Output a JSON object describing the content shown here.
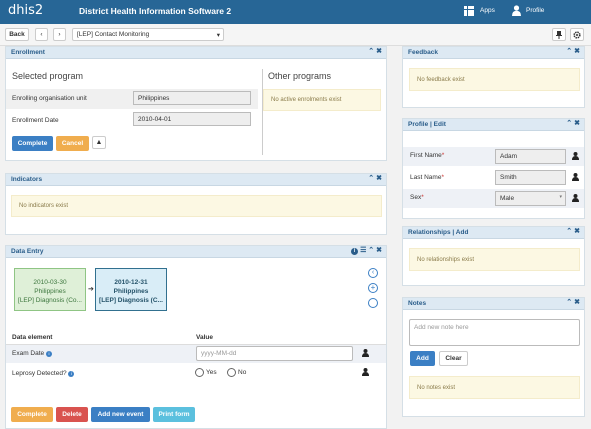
{
  "header": {
    "logo": "dhis2",
    "title": "District Health Information Software 2",
    "apps": "Apps",
    "profile": "Profile"
  },
  "toolbar": {
    "back": "Back",
    "prev": "‹",
    "next": "›",
    "program_select": "[LEP] Contact Monitoring",
    "caret": "▾"
  },
  "enrollment": {
    "title": "Enrollment",
    "selected_program": "Selected program",
    "org_unit_label": "Enrolling organisation unit",
    "org_unit_value": "Philippines",
    "date_label": "Enrollment Date",
    "date_value": "2010-04-01",
    "complete": "Complete",
    "cancel": "Cancel",
    "warn": "▲",
    "other_programs": "Other programs",
    "no_active": "No active enrolments exist"
  },
  "indicators": {
    "title": "Indicators",
    "empty": "No indicators exist"
  },
  "data_entry": {
    "title": "Data Entry",
    "events": [
      {
        "date": "2010-03-30",
        "org": "Philippines",
        "stage": "[LEP] Diagnosis (Co..."
      },
      {
        "date": "2010-12-31",
        "org": "Philippines",
        "stage": "[LEP] Diagnosis (C..."
      }
    ],
    "arrow": "➔",
    "col_element": "Data element",
    "col_value": "Value",
    "exam_date_label": "Exam Date",
    "exam_date_placeholder": "yyyy-MM-dd",
    "leprosy_label": "Leprosy Detected?",
    "yes": "Yes",
    "no": "No",
    "complete": "Complete",
    "delete": "Delete",
    "add_event": "Add new event",
    "print": "Print form"
  },
  "feedback": {
    "title": "Feedback",
    "empty": "No feedback exist"
  },
  "profile": {
    "title": "Profile | Edit",
    "first_name_label": "First Name",
    "first_name": "Adam",
    "last_name_label": "Last Name",
    "last_name": "Smith",
    "sex_label": "Sex",
    "sex": "Male",
    "required": "*"
  },
  "relationships": {
    "title": "Relationships | Add",
    "empty": "No relationships exist"
  },
  "notes": {
    "title": "Notes",
    "placeholder": "Add new note here",
    "add": "Add",
    "clear": "Clear",
    "empty": "No notes exist"
  },
  "icons": {
    "collapse": "⌃",
    "close": "✖",
    "info": "i",
    "list": "☰"
  },
  "colors": {
    "header": "#276696",
    "panel_header": "#dde9f3",
    "info_bg": "#fcf8e3",
    "btn_blue": "#3b7fc4",
    "btn_orange": "#f0ad4e",
    "btn_red": "#d9534f",
    "btn_cyan": "#5bc0de",
    "required": "#c9302c"
  }
}
